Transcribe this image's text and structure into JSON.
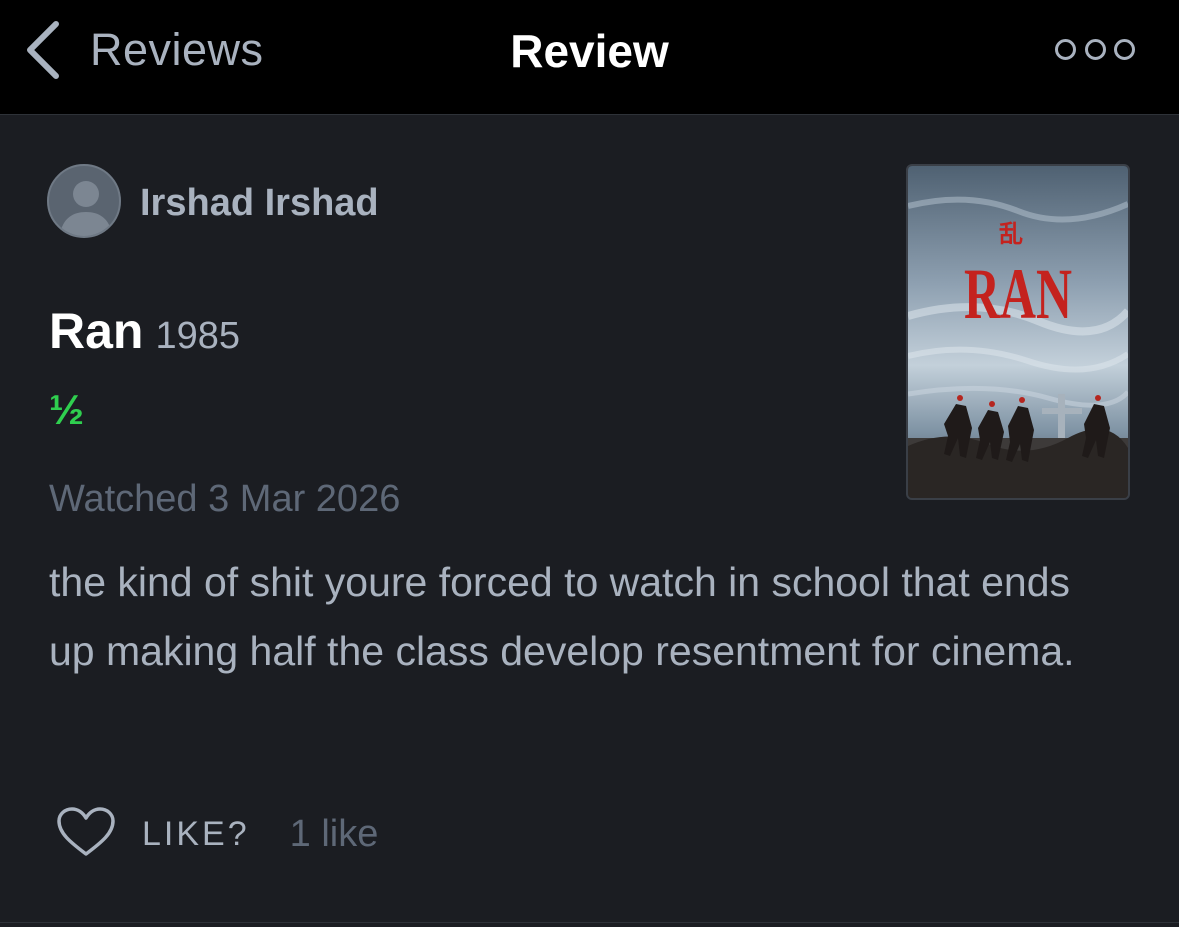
{
  "nav": {
    "back_label": "Reviews",
    "title": "Review",
    "more_icon": "ellipsis-icon",
    "back_icon": "chevron-left-icon"
  },
  "review": {
    "author": "Irshad Irshad",
    "film_title": "Ran",
    "film_year": "1985",
    "rating": "½",
    "watched": "Watched 3 Mar 2026",
    "body": "the kind of shit youre forced to watch in school that ends up making half the class develop resentment for cinema."
  },
  "poster": {
    "kanji": "乱",
    "title": "RAN"
  },
  "actions": {
    "like_label": "LIKE?",
    "like_count": "1 like",
    "like_icon": "heart-icon"
  },
  "colors": {
    "background": "#1b1d22",
    "navbar": "#000000",
    "text_primary": "#ffffff",
    "text_secondary": "#a9b2bf",
    "text_muted": "#5e6877",
    "rating_green": "#2fcf4f",
    "poster_title_red": "#c4221e"
  }
}
